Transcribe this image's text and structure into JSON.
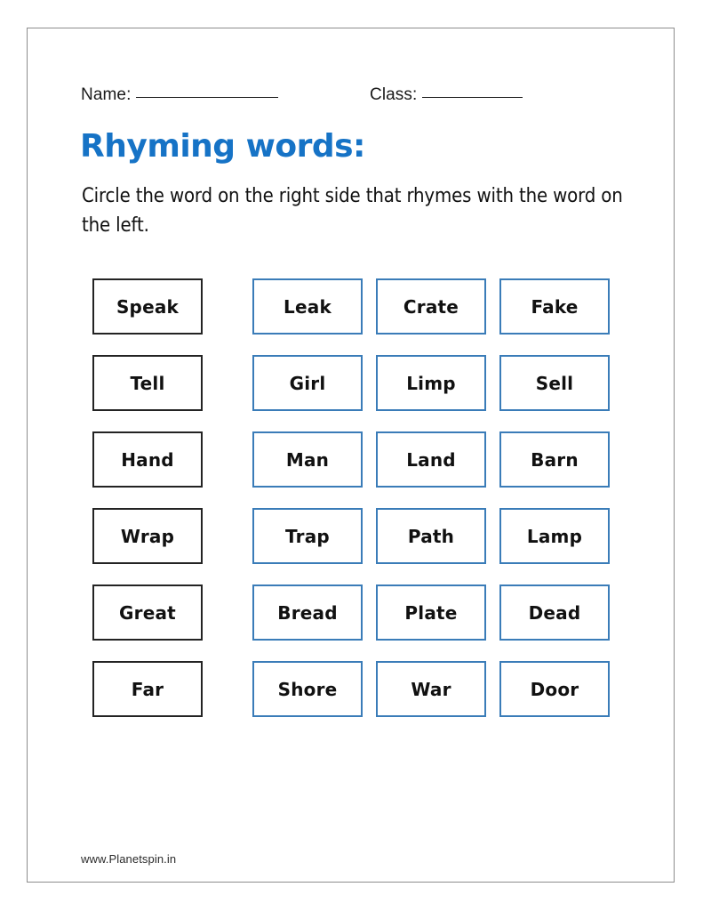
{
  "page": {
    "header_fields": [
      {
        "label": "Name:",
        "value": "",
        "rule_class": "rule-name",
        "pos_class": "field-name"
      },
      {
        "label": "Class:",
        "value": "",
        "rule_class": "rule-class",
        "pos_class": "field-class"
      }
    ],
    "title": "Rhyming words:",
    "instruction": "Circle the word on the right side that rhymes with the word on the left.",
    "footer": "www.Planetspin.in",
    "colors": {
      "title_blue": "#1673C6",
      "option_border_blue": "#3A7CB8",
      "prompt_border_black": "#232323",
      "page_border_gray": "#8D8D8D",
      "text_black": "#111111"
    }
  },
  "exercise": {
    "rows": [
      {
        "prompt": "Speak",
        "options": [
          "Leak",
          "Crate",
          "Fake"
        ]
      },
      {
        "prompt": "Tell",
        "options": [
          "Girl",
          "Limp",
          "Sell"
        ]
      },
      {
        "prompt": "Hand",
        "options": [
          "Man",
          "Land",
          "Barn"
        ]
      },
      {
        "prompt": "Wrap",
        "options": [
          "Trap",
          "Path",
          "Lamp"
        ]
      },
      {
        "prompt": "Great",
        "options": [
          "Bread",
          "Plate",
          "Dead"
        ]
      },
      {
        "prompt": "Far",
        "options": [
          "Shore",
          "War",
          "Door"
        ]
      }
    ]
  }
}
